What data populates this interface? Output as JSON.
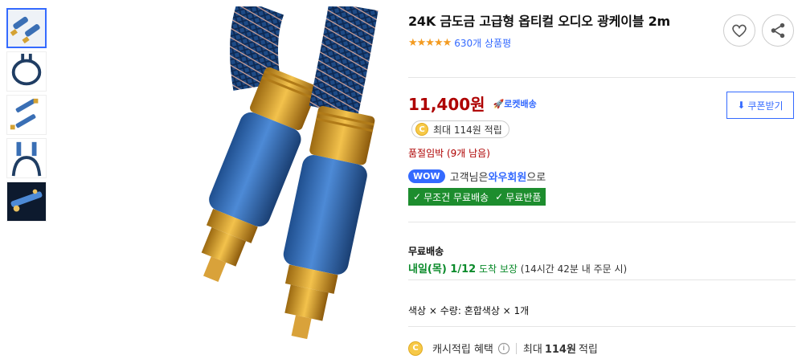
{
  "product": {
    "title": "24K 금도금 고급형 옵티컬 오디오 광케이블 2m",
    "review_count": "630개 상품평",
    "rating": 5,
    "price": "11,400원",
    "delivery_badge": "로켓배송",
    "coupon_label": "쿠폰받기",
    "points_chip": "최대 114원 적립",
    "stock_notice": "품절임박 (9개 남음)"
  },
  "wow": {
    "badge": "WOW",
    "prefix": "고객님은 ",
    "member": "와우회원",
    "suffix": "으로",
    "free_ship": "무조건 무료배송",
    "free_return": "무료반품"
  },
  "shipping": {
    "label": "무료배송",
    "date": "내일(목) 1/12",
    "guarantee": " 도착 보장",
    "condition": " (14시간 42분 내 주문 시)"
  },
  "option": {
    "text": "색상 × 수량: 혼합색상 × 1개"
  },
  "benefit": {
    "label": "캐시적립 혜택",
    "prefix": "최대",
    "amount": "114원",
    "suffix": "적립"
  },
  "colors": {
    "price": "#ae0000",
    "accent": "#346aff",
    "green": "#1d8d2e"
  }
}
